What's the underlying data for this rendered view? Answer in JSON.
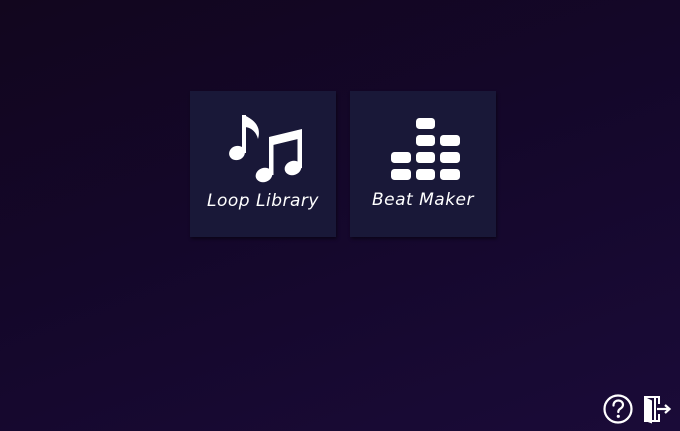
{
  "tiles": [
    {
      "label": "Loop Library",
      "icon": "music-notes-icon"
    },
    {
      "label": "Beat Maker",
      "icon": "equalizer-icon"
    }
  ],
  "footer": {
    "help_icon": "help-icon",
    "exit_icon": "exit-icon"
  },
  "colors": {
    "background": "#14072a",
    "tile": "#191838",
    "foreground": "#ffffff"
  }
}
